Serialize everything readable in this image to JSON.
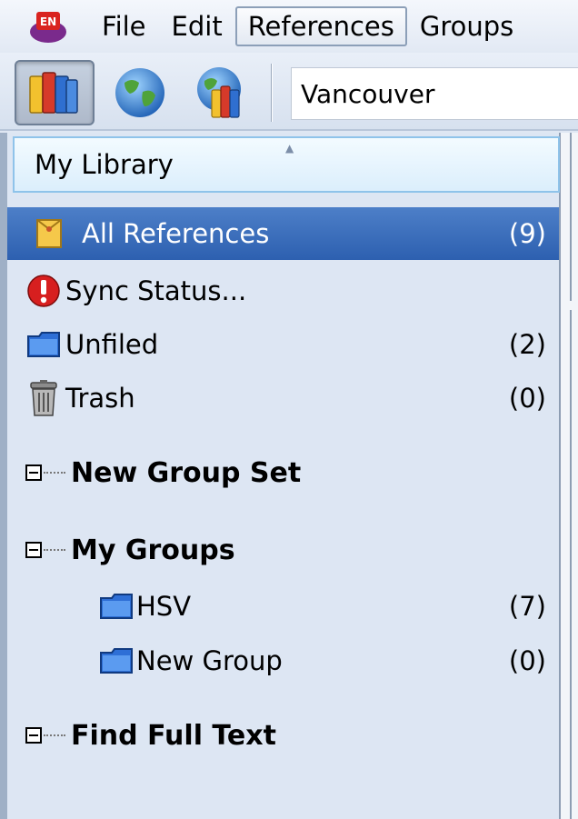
{
  "menu": {
    "items": [
      "File",
      "Edit",
      "References",
      "Groups"
    ],
    "active": "References"
  },
  "toolbar": {
    "output_style": "Vancouver",
    "buttons": [
      {
        "name": "local-library-mode",
        "icon": "books-icon",
        "pressed": true
      },
      {
        "name": "online-search-mode",
        "icon": "globe-icon",
        "pressed": false
      },
      {
        "name": "integrated-library-mode",
        "icon": "books-globe-icon",
        "pressed": false
      }
    ]
  },
  "groups_panel": {
    "header": "My Library",
    "library_items": [
      {
        "label": "All References",
        "count": "(9)",
        "icon": "all-references-icon",
        "selected": true
      },
      {
        "label": "Sync Status...",
        "count": "",
        "icon": "sync-alert-icon",
        "selected": false
      },
      {
        "label": "Unfiled",
        "count": "(2)",
        "icon": "folder-icon",
        "selected": false
      },
      {
        "label": "Trash",
        "count": "(0)",
        "icon": "trash-icon",
        "selected": false
      }
    ],
    "group_sets": [
      {
        "label": "New Group Set",
        "groups": []
      },
      {
        "label": "My Groups",
        "groups": [
          {
            "label": "HSV",
            "count": "(7)"
          },
          {
            "label": "New Group",
            "count": "(0)"
          }
        ]
      },
      {
        "label": "Find Full Text",
        "groups": []
      }
    ]
  },
  "colors": {
    "selection": "#2d60b0",
    "panel_background": "#dde6f3",
    "header_border": "#8fc3ea"
  }
}
